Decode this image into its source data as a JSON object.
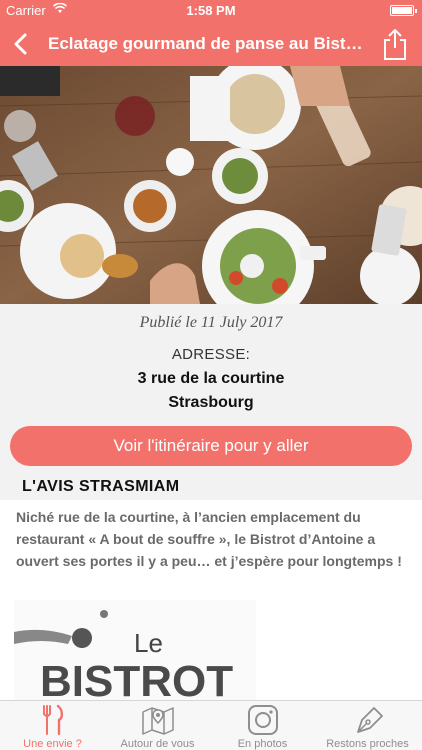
{
  "status_bar": {
    "carrier": "Carrier",
    "time": "1:58 PM"
  },
  "nav": {
    "title": "Eclatage gourmand de panse au Bistrot d'Antoine"
  },
  "post": {
    "published": "Publié le 11 July 2017",
    "address_label": "ADRESSE:",
    "address_line1": "3 rue de la courtine",
    "address_line2": "Strasbourg",
    "route_button": "Voir l'itinéraire pour y aller",
    "review_title": "L'AVIS STRASMIAM",
    "review_text": "Niché rue de la courtine, à l’ancien emplacement du restaurant « A bout de souffre », le Bistrot d’Antoine a ouvert ses portes il y a peu… et j’espère pour longtemps !",
    "logo": {
      "line1": "Le",
      "line2": "BISTROT"
    }
  },
  "tabs": [
    {
      "label": "Une envie ?",
      "icon": "fork-knife-icon",
      "active": true
    },
    {
      "label": "Autour de vous",
      "icon": "map-icon",
      "active": false
    },
    {
      "label": "En photos",
      "icon": "camera-icon",
      "active": false
    },
    {
      "label": "Restons proches",
      "icon": "pen-nib-icon",
      "active": false
    }
  ],
  "colors": {
    "accent": "#f3716b",
    "tab_inactive": "#8e8e8e"
  }
}
